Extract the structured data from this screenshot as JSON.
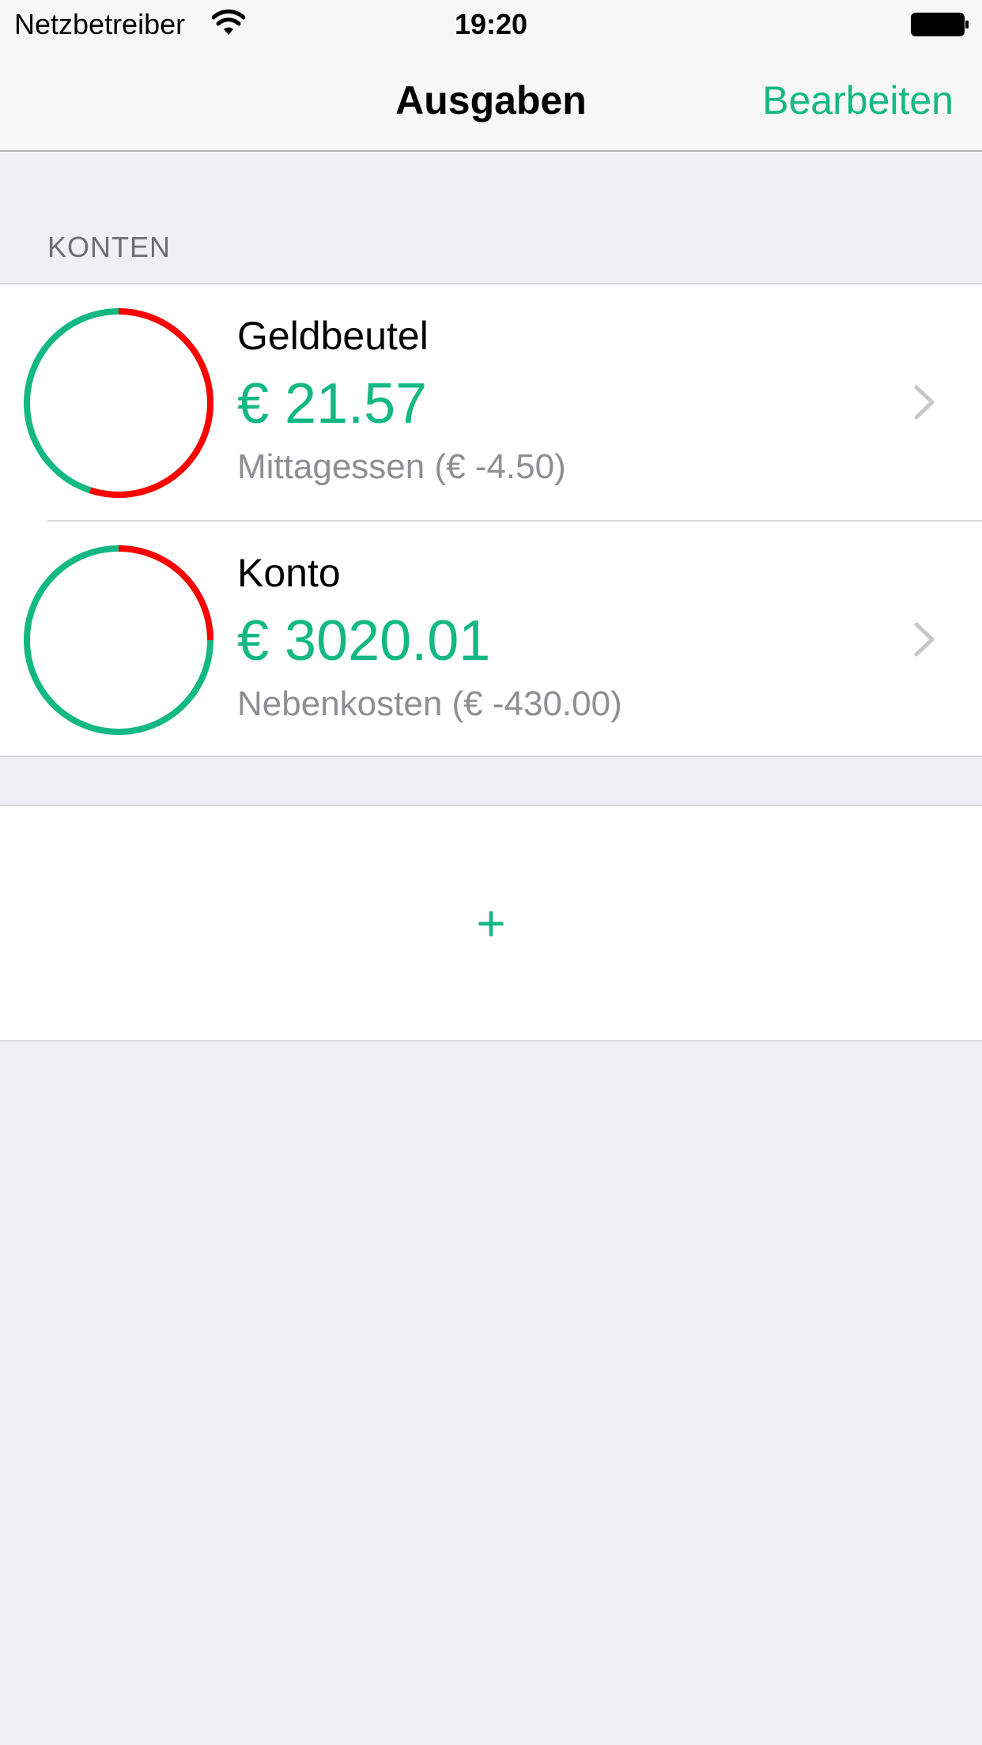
{
  "status_bar": {
    "carrier": "Netzbetreiber",
    "time": "19:20",
    "wifi_icon": "wifi-icon",
    "battery_icon": "battery-icon"
  },
  "nav": {
    "title": "Ausgaben",
    "edit_label": "Bearbeiten"
  },
  "section": {
    "header": "KONTEN"
  },
  "accounts": [
    {
      "name": "Geldbeutel",
      "amount": "€ 21.57",
      "last_transaction": "Mittagessen (€ -4.50)",
      "ring_spent_fraction": 0.55
    },
    {
      "name": "Konto",
      "amount": "€ 3020.01",
      "last_transaction": "Nebenkosten (€ -430.00)",
      "ring_spent_fraction": 0.25
    }
  ],
  "add": {
    "label": "+"
  },
  "colors": {
    "accent": "#14b883",
    "spent": "#ff0000",
    "background": "#efeff4"
  }
}
